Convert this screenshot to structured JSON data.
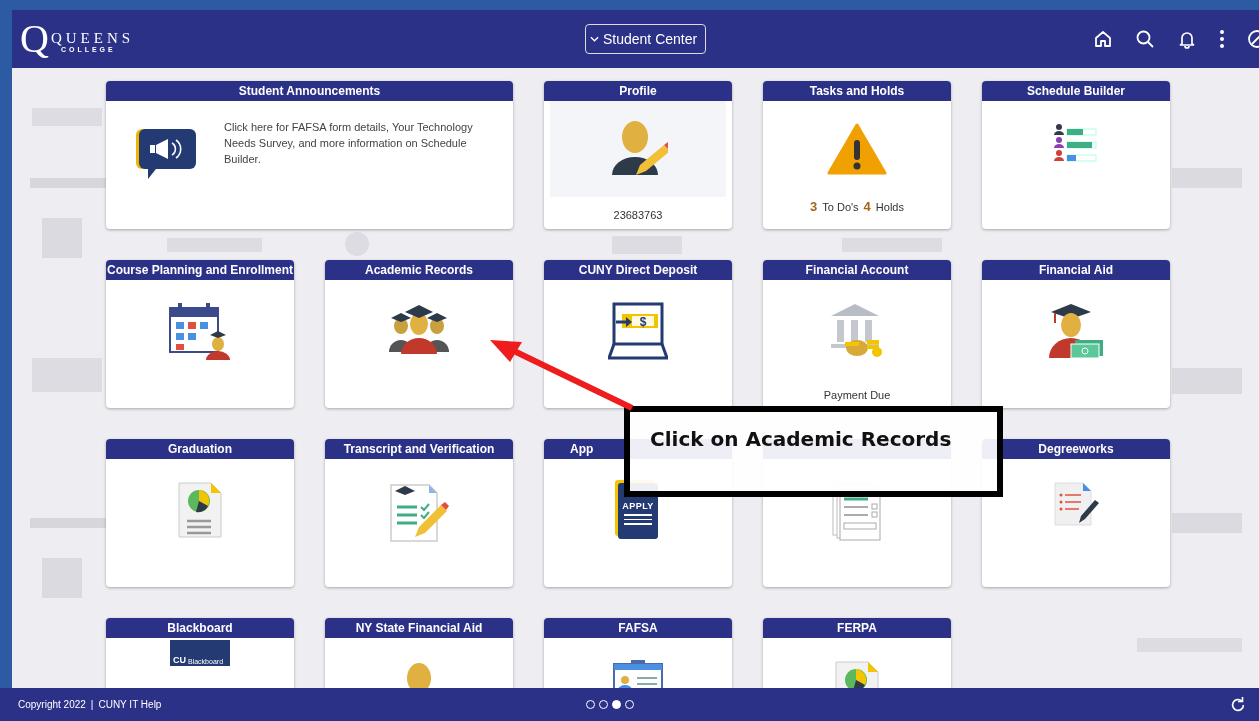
{
  "header": {
    "logo": {
      "letter": "Q",
      "name": "QUEENS",
      "sub": "COLLEGE"
    },
    "menu": {
      "label": "Student Center"
    }
  },
  "background": {
    "kind": "logos"
  },
  "tiles": [
    {
      "title": "Student Announcements",
      "kind": "announcement",
      "text": "Click here for FAFSA form details, Your Technology Needs Survey, and more information on Schedule Builder."
    },
    {
      "title": "Profile",
      "kind": "profile",
      "text": "23683763"
    },
    {
      "title": "Tasks and Holds",
      "kind": "tasks",
      "todos": "3",
      "todos_label": "To Do's",
      "holds": "4",
      "holds_label": "Holds"
    },
    {
      "title": "Schedule Builder",
      "kind": "plain"
    },
    {
      "title": "Course Planning and Enrollment",
      "kind": "plain"
    },
    {
      "title": "Academic Records",
      "kind": "plain"
    },
    {
      "title": "CUNY Direct Deposit",
      "kind": "plain",
      "icon_text": "$"
    },
    {
      "title": "Financial Account",
      "kind": "status",
      "text": "Payment Due"
    },
    {
      "title": "Financial Aid",
      "kind": "plain"
    },
    {
      "title": "Graduation",
      "kind": "plain"
    },
    {
      "title": "Transcript and Verification",
      "kind": "plain"
    },
    {
      "title": "App",
      "kind": "plain",
      "icon_text": "APPLY"
    },
    {
      "kind": "plain"
    },
    {
      "title": "Degreeworks",
      "kind": "plain"
    },
    {
      "title": "Blackboard",
      "kind": "plain",
      "icon_text": "CU",
      "icon_text2": "Blackboard"
    },
    {
      "title": "NY State Financial Aid",
      "kind": "plain"
    },
    {
      "title": "FAFSA",
      "kind": "plain"
    },
    {
      "title": "FERPA",
      "kind": "plain"
    }
  ],
  "callout": {
    "text": "Click on Academic Records"
  },
  "footer": {
    "copyright": "Copyright 2022",
    "separator": "|",
    "link": "CUNY IT Help",
    "pages": [
      {
        "selected": false
      },
      {
        "selected": false
      },
      {
        "selected": true
      },
      {
        "selected": false
      }
    ]
  }
}
